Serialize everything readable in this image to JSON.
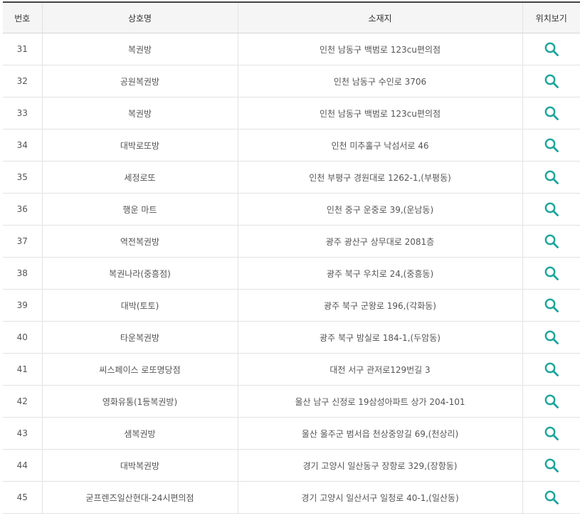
{
  "table": {
    "headers": {
      "num": "번호",
      "name": "상호명",
      "address": "소재지",
      "view": "위치보기"
    },
    "accent_color": "#1aa59a",
    "view_icon": "search-icon",
    "rows": [
      {
        "num": "31",
        "name": "복권방",
        "address": "인천 남동구 백범로 123cu편의점"
      },
      {
        "num": "32",
        "name": "공원복권방",
        "address": "인천 남동구 수인로 3706"
      },
      {
        "num": "33",
        "name": "복권방",
        "address": "인천 남동구 백범로 123cu편의점"
      },
      {
        "num": "34",
        "name": "대박로또방",
        "address": "인천 미추홀구 낙섬서로 46"
      },
      {
        "num": "35",
        "name": "세정로또",
        "address": "인천 부평구 경원대로 1262-1,(부평동)"
      },
      {
        "num": "36",
        "name": "행운 마트",
        "address": "인천 중구 운중로 39,(운남동)"
      },
      {
        "num": "37",
        "name": "역전복권방",
        "address": "광주 광산구 상무대로 2081층"
      },
      {
        "num": "38",
        "name": "복권나라(중흥점)",
        "address": "광주 북구 우치로 24,(중흥동)"
      },
      {
        "num": "39",
        "name": "대박(토토)",
        "address": "광주 북구 군왕로 196,(각화동)"
      },
      {
        "num": "40",
        "name": "타운복권방",
        "address": "광주 북구 밤실로 184-1,(두암동)"
      },
      {
        "num": "41",
        "name": "씨스페이스 로또명당점",
        "address": "대전 서구 관저로129번길 3"
      },
      {
        "num": "42",
        "name": "영화유통(1등복권방)",
        "address": "울산 남구 신정로 19삼성아파트 상가 204-101"
      },
      {
        "num": "43",
        "name": "샘복권방",
        "address": "울산 울주군 범서읍 천상중앙길 69,(천상리)"
      },
      {
        "num": "44",
        "name": "대박복권방",
        "address": "경기 고양시 일산동구 장항로 329,(장항동)"
      },
      {
        "num": "45",
        "name": "굳프렌즈일산현대-24시편의점",
        "address": "경기 고양시 일산서구 일청로 40-1,(일산동)"
      }
    ]
  }
}
